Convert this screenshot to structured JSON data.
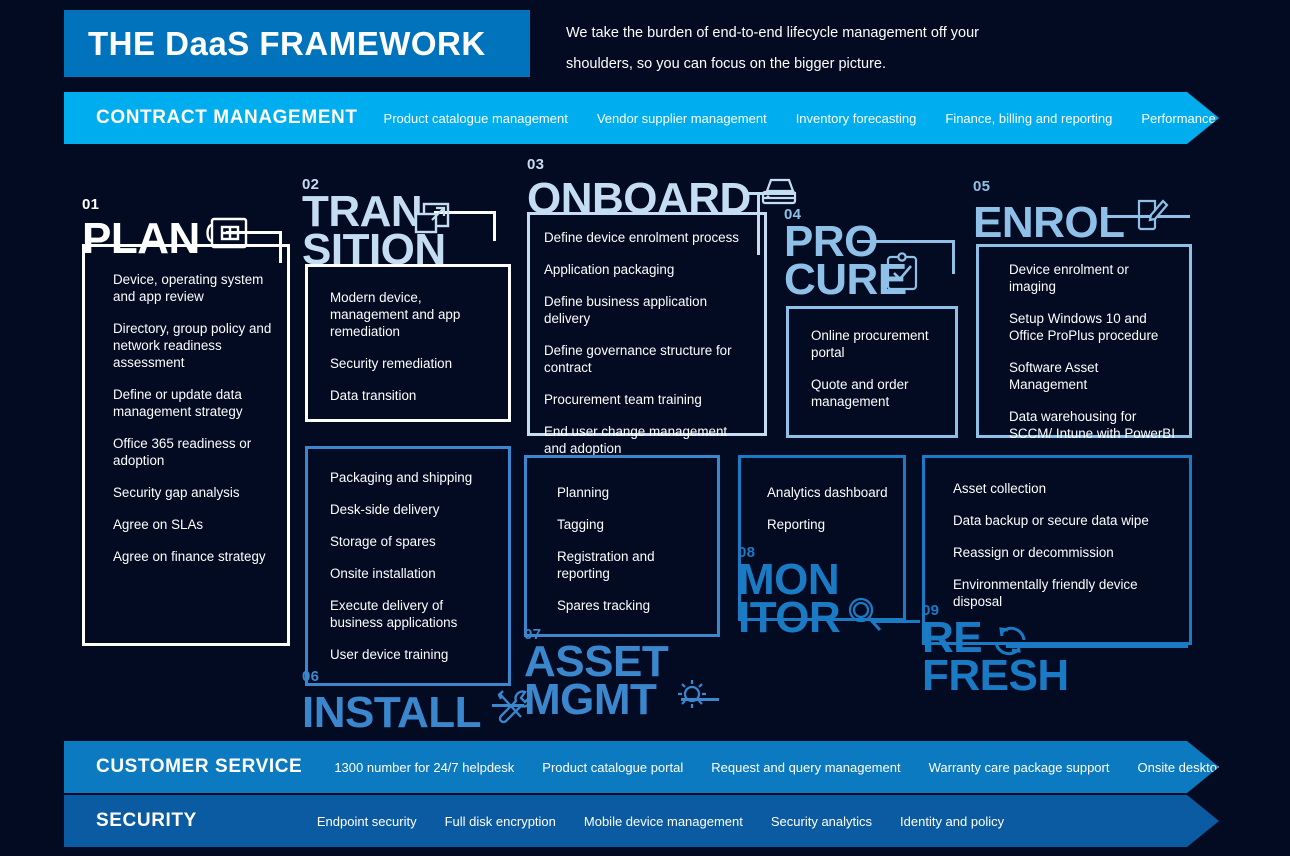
{
  "header": {
    "title": "THE DaaS FRAMEWORK",
    "tagline": "We take the burden of end-to-end lifecycle management off your shoulders, so you can focus on the bigger picture."
  },
  "contract_bar": {
    "title": "CONTRACT MANAGEMENT",
    "items": [
      "Product catalogue management",
      "Vendor supplier management",
      "Inventory forecasting",
      "Finance, billing and reporting",
      "Performance management"
    ]
  },
  "customer_bar": {
    "title": "CUSTOMER SERVICE",
    "items": [
      "1300 number for 24/7 helpdesk",
      "Product catalogue portal",
      "Request and query management",
      "Warranty care package support",
      "Onsite desktop support"
    ]
  },
  "security_bar": {
    "title": "SECURITY",
    "items": [
      "Endpoint security",
      "Full disk encryption",
      "Mobile device management",
      "Security analytics",
      "Identity and policy"
    ]
  },
  "stages": [
    {
      "number": "01",
      "name": "PLAN",
      "name_lines": [
        "PLAN"
      ],
      "icon": "blueprint-icon",
      "color": "#ffffff",
      "items": [
        "Device, operating system and app review",
        "Directory, group policy and network readiness assessment",
        "Define or update data management strategy",
        "Office 365 readiness or adoption",
        "Security gap analysis",
        "Agree on SLAs",
        "Agree on finance strategy"
      ]
    },
    {
      "number": "02",
      "name": "TRANSITION",
      "name_lines": [
        "TRAN",
        "SITION"
      ],
      "icon": "transfer-arrow-icon",
      "color": "#c5ddf2",
      "items": [
        "Modern device,  management and app remediation",
        "Security remediation",
        "Data transition"
      ]
    },
    {
      "number": "03",
      "name": "ONBOARD",
      "name_lines": [
        "ONBOARD"
      ],
      "icon": "printer-icon",
      "color": "#c5ddf2",
      "items": [
        "Define device enrolment process",
        "Application packaging",
        "Define business application delivery",
        "Define governance structure for contract",
        "Procurement team training",
        "End user change management and adoption"
      ]
    },
    {
      "number": "04",
      "name": "PROCURE",
      "name_lines": [
        "PRO",
        "CURE"
      ],
      "icon": "clipboard-check-icon",
      "color": "#8fc0e8",
      "items": [
        "Online procurement portal",
        "Quote and order management"
      ]
    },
    {
      "number": "05",
      "name": "ENROL",
      "name_lines": [
        "ENROL"
      ],
      "icon": "pencil-document-icon",
      "color": "#8fc0e8",
      "items": [
        "Device enrolment or imaging",
        "Setup Windows 10 and Office ProPlus procedure",
        "Software Asset Management",
        "Data warehousing for SCCM/ Intune with PowerBI"
      ]
    },
    {
      "number": "06",
      "name": "INSTALL",
      "name_lines": [
        "INSTALL"
      ],
      "icon": "tools-icon",
      "color": "#3b87ce",
      "items": [
        "Packaging and shipping",
        "Desk-side delivery",
        "Storage of spares",
        "Onsite installation",
        "Execute delivery of business applications",
        "User device training"
      ]
    },
    {
      "number": "07",
      "name": "ASSET MGMT",
      "name_lines": [
        "ASSET",
        "MGMT"
      ],
      "icon": "gear-icon",
      "color": "#3b87ce",
      "items": [
        "Planning",
        "Tagging",
        "Registration and reporting",
        "Spares tracking"
      ]
    },
    {
      "number": "08",
      "name": "MONITOR",
      "name_lines": [
        "MON",
        "ITOR"
      ],
      "icon": "magnifier-icon",
      "color": "#1b7ac4",
      "items": [
        "Analytics dashboard",
        "Reporting"
      ]
    },
    {
      "number": "09",
      "name": "REFRESH",
      "name_lines": [
        "RE",
        "FRESH"
      ],
      "icon": "recycle-arrows-icon",
      "color": "#1b7ac4",
      "items": [
        "Asset collection",
        "Data backup or secure data wipe",
        "Reassign or decommission",
        "Environmentally friendly device disposal"
      ]
    }
  ],
  "colors": {
    "background": "#030b22",
    "title_box": "#0073bc",
    "contract_bar": "#00adee",
    "customer_bar": "#0c7ac0",
    "security_bar": "#0b5ba2"
  }
}
